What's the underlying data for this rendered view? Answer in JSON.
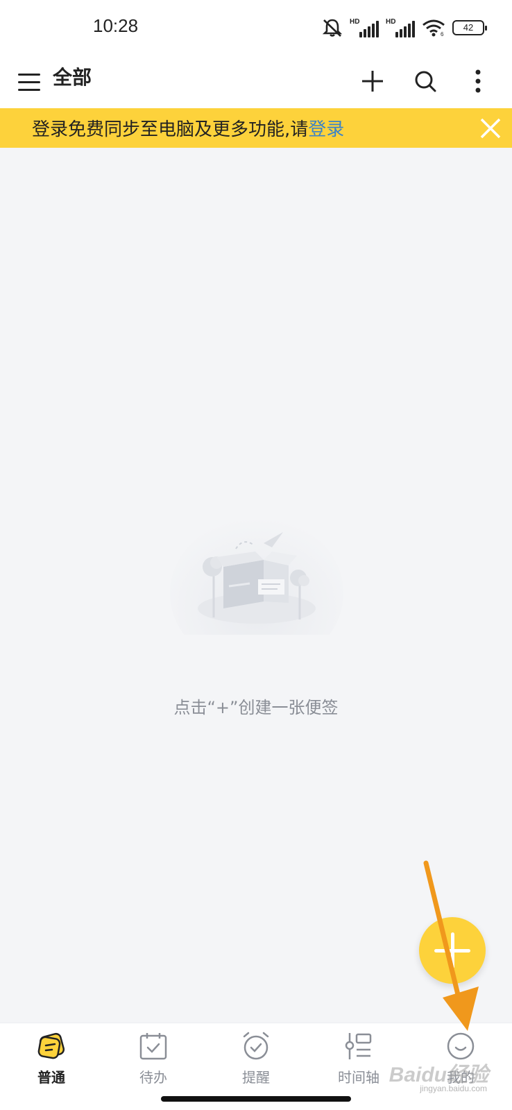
{
  "status_bar": {
    "time": "10:28",
    "hd_label": "HD",
    "battery": "42",
    "icons": [
      "mute-icon",
      "hd-signal-icon",
      "hd-signal-icon",
      "wifi-icon",
      "battery-icon"
    ]
  },
  "app_bar": {
    "title": "全部",
    "actions": [
      "add-icon",
      "search-icon",
      "more-icon"
    ]
  },
  "login_banner": {
    "text": "登录免费同步至电脑及更多功能,请",
    "link": "登录",
    "background": "#fdd23b",
    "link_color": "#3a83c8"
  },
  "empty_state": {
    "hint": "点击“+”创建一张便签"
  },
  "fab": {
    "icon": "plus-icon",
    "color": "#fdd23b"
  },
  "tabs": [
    {
      "label": "普通",
      "icon": "notes-icon",
      "active": true
    },
    {
      "label": "待办",
      "icon": "calendar-check-icon",
      "active": false
    },
    {
      "label": "提醒",
      "icon": "alarm-clock-icon",
      "active": false
    },
    {
      "label": "时间轴",
      "icon": "timeline-icon",
      "active": false
    },
    {
      "label": "我的",
      "icon": "smile-icon",
      "active": false
    }
  ],
  "watermark": {
    "text": "Baidu经验",
    "sub": "jingyan.baidu.com"
  },
  "annotation": {
    "arrow_color": "#f0981c"
  }
}
